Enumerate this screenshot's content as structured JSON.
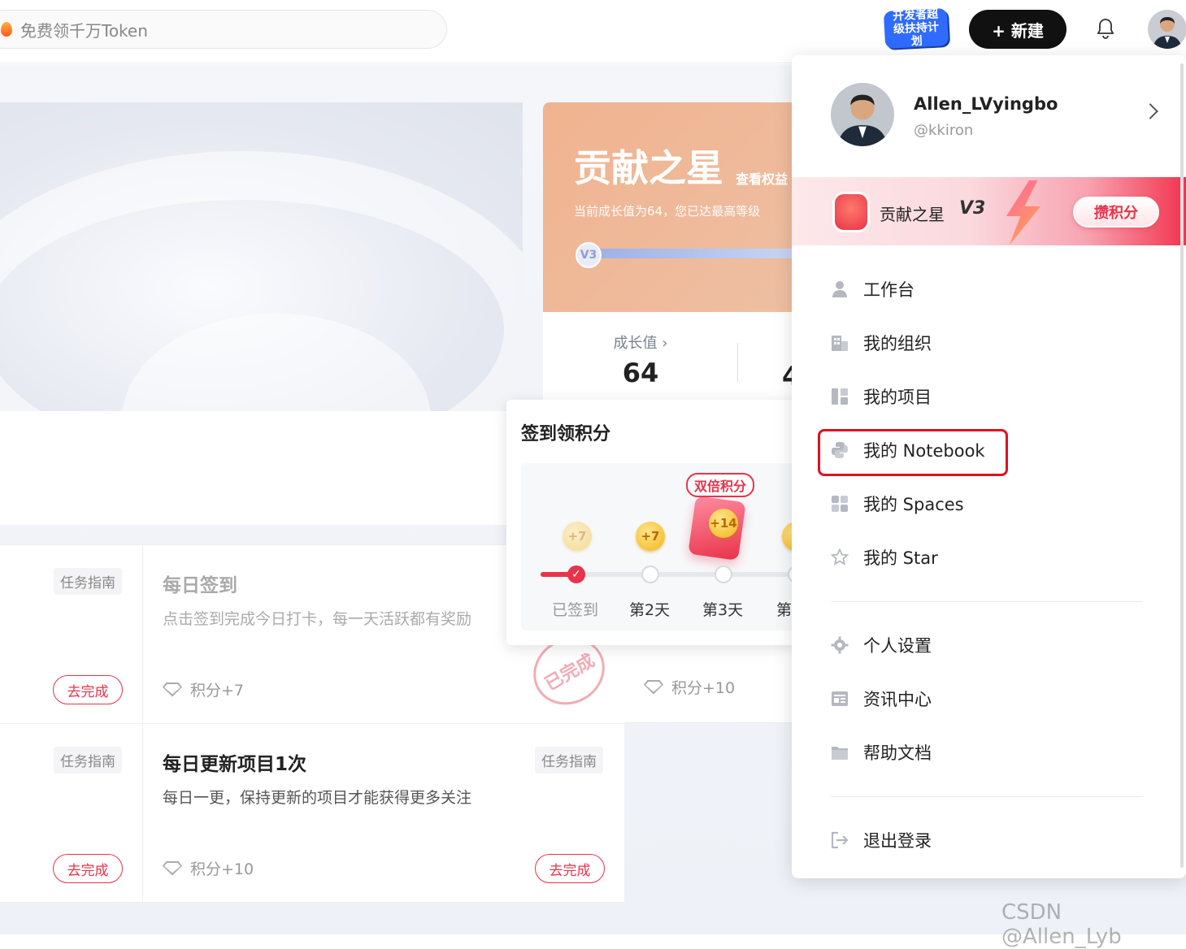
{
  "header": {
    "search_placeholder": "免费领千万Token",
    "dev_badge": "开发者超级扶持计划",
    "new_button": "+ 新建"
  },
  "level_card": {
    "title": "贡献之星",
    "link": "查看权益",
    "subtitle": "当前成长值为64，您已达最高等级",
    "badge": "V3",
    "growth_label": "成长值",
    "growth_value": "64",
    "second_value": "4"
  },
  "checkin": {
    "title": "签到领积分",
    "double_label": "双倍积分",
    "coins": [
      "+7",
      "+7",
      "+14",
      "+"
    ],
    "days": [
      "已签到",
      "第2天",
      "第3天",
      "第"
    ]
  },
  "tasks": [
    {
      "tag": "任务指南",
      "go": "去完成"
    },
    {
      "title": "每日签到",
      "desc": "点击签到完成今日打卡，每一天活跃都有奖励",
      "points": "积分+7",
      "stamp": "已完成"
    },
    {
      "points": "积分+10"
    },
    {
      "tag": "任务指南",
      "go": "去完成"
    },
    {
      "title": "每日更新项目1次",
      "desc": "每日一更，保持更新的项目才能获得更多关注",
      "points": "积分+10",
      "tag": "任务指南",
      "go": "去完成"
    }
  ],
  "user_menu": {
    "name": "Allen_LVyingbo",
    "handle": "@kkiron",
    "level_label": "贡献之星",
    "level_badge": "V3",
    "earn_button": "攒积分",
    "items": [
      "工作台",
      "我的组织",
      "我的项目",
      "我的 Notebook",
      "我的 Spaces",
      "我的 Star"
    ],
    "items2": [
      "个人设置",
      "资讯中心",
      "帮助文档"
    ],
    "logout": "退出登录"
  },
  "watermark": "CSDN @Allen_Lyb",
  "colors": {
    "accent": "#e8334a",
    "highlight": "#e0101e"
  }
}
